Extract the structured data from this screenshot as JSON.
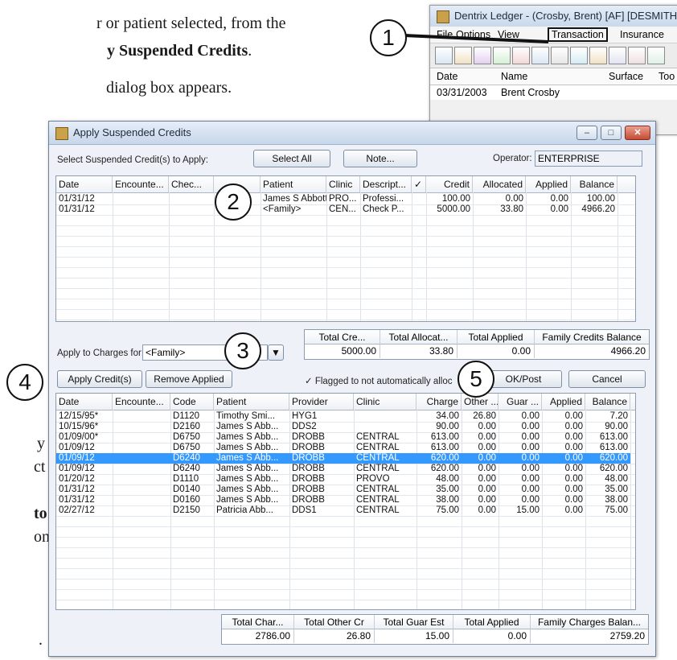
{
  "doc_text": {
    "line1": "r or patient selected, from the",
    "line2_prefix": "y ",
    "line2_bold": "Suspended Credits",
    "line2_suffix": ".",
    "line3": "dialog box appears.",
    "frag_y": "y",
    "frag_ct": "ct",
    "frag_to": "to",
    "frag_on": "on,",
    "frag_dot": "."
  },
  "ledger": {
    "title": "Dentrix Ledger - (Crosby, Brent) [AF] [DESMITH]",
    "menu": [
      "File",
      "Options",
      "View",
      "Transaction",
      "Insurance"
    ],
    "columns": [
      "Date",
      "Name",
      "Surface",
      "Too"
    ],
    "row": {
      "date": "03/31/2003",
      "name": "Brent Crosby"
    }
  },
  "dialog": {
    "title": "Apply Suspended Credits",
    "select_label": "Select Suspended Credit(s) to Apply:",
    "select_all": "Select All",
    "note": "Note...",
    "operator_label": "Operator:",
    "operator_value": "ENTERPRISE",
    "credits_columns": [
      "Date",
      "Encounte...",
      "Chec...",
      "",
      "Patient",
      "Clinic",
      "Descript...",
      "✓",
      "Credit",
      "Allocated",
      "Applied",
      "Balance"
    ],
    "credits_rows": [
      [
        "01/31/12",
        "",
        "",
        "",
        "James S Abbott",
        "PRO...",
        "Professi...",
        "",
        "100.00",
        "0.00",
        "0.00",
        "100.00"
      ],
      [
        "01/31/12",
        "",
        "",
        "",
        "<Family>",
        "CEN...",
        "Check P...",
        "",
        "5000.00",
        "33.80",
        "0.00",
        "4966.20"
      ]
    ],
    "credit_totals": {
      "headers": [
        "Total Cre...",
        "Total Allocat...",
        "Total Applied",
        "Family Credits Balance"
      ],
      "values": [
        "5000.00",
        "33.80",
        "0.00",
        "4966.20"
      ]
    },
    "apply_charges_label": "Apply to Charges for:",
    "apply_charges_value": "<Family>",
    "apply_credits": "Apply Credit(s)",
    "remove_applied": "Remove Applied",
    "flag_note": "✓ Flagged to not automatically alloc",
    "ok_post": "OK/Post",
    "cancel": "Cancel",
    "charge_columns": [
      "Date",
      "Encounte...",
      "Code",
      "Patient",
      "Provider",
      "Clinic",
      "Charge",
      "Other ...",
      "Guar ...",
      "Applied",
      "Balance"
    ],
    "charge_rows": [
      [
        "12/15/95*",
        "",
        "D1120",
        "Timothy Smi...",
        "HYG1",
        "",
        "34.00",
        "26.80",
        "0.00",
        "0.00",
        "7.20"
      ],
      [
        "10/15/96*",
        "",
        "D2160",
        "James S Abb...",
        "DDS2",
        "",
        "90.00",
        "0.00",
        "0.00",
        "0.00",
        "90.00"
      ],
      [
        "01/09/00*",
        "",
        "D6750",
        "James S Abb...",
        "DROBB",
        "CENTRAL",
        "613.00",
        "0.00",
        "0.00",
        "0.00",
        "613.00"
      ],
      [
        "01/09/12",
        "",
        "D6750",
        "James S Abb...",
        "DROBB",
        "CENTRAL",
        "613.00",
        "0.00",
        "0.00",
        "0.00",
        "613.00"
      ],
      [
        "01/09/12",
        "",
        "D6240",
        "James S Abb...",
        "DROBB",
        "CENTRAL",
        "620.00",
        "0.00",
        "0.00",
        "0.00",
        "620.00"
      ],
      [
        "01/09/12",
        "",
        "D6240",
        "James S Abb...",
        "DROBB",
        "CENTRAL",
        "620.00",
        "0.00",
        "0.00",
        "0.00",
        "620.00"
      ],
      [
        "01/20/12",
        "",
        "D1110",
        "James S Abb...",
        "DROBB",
        "PROVO",
        "48.00",
        "0.00",
        "0.00",
        "0.00",
        "48.00"
      ],
      [
        "01/31/12",
        "",
        "D0140",
        "James S Abb...",
        "DROBB",
        "CENTRAL",
        "35.00",
        "0.00",
        "0.00",
        "0.00",
        "35.00"
      ],
      [
        "01/31/12",
        "",
        "D0160",
        "James S Abb...",
        "DROBB",
        "CENTRAL",
        "38.00",
        "0.00",
        "0.00",
        "0.00",
        "38.00"
      ],
      [
        "02/27/12",
        "",
        "D2150",
        "Patricia Abb...",
        "DDS1",
        "CENTRAL",
        "75.00",
        "0.00",
        "15.00",
        "0.00",
        "75.00"
      ]
    ],
    "selected_charge_row": 4,
    "charge_totals": {
      "headers": [
        "Total Char...",
        "Total Other Cr",
        "Total Guar Est",
        "Total Applied",
        "Family Charges Balan..."
      ],
      "values": [
        "2786.00",
        "26.80",
        "15.00",
        "0.00",
        "2759.20"
      ]
    }
  },
  "callouts": [
    "1",
    "2",
    "3",
    "4",
    "5"
  ],
  "colors": {
    "selection": "#3399ff",
    "callout_border": "#111111",
    "dialog_bg": "#eef2f8"
  }
}
